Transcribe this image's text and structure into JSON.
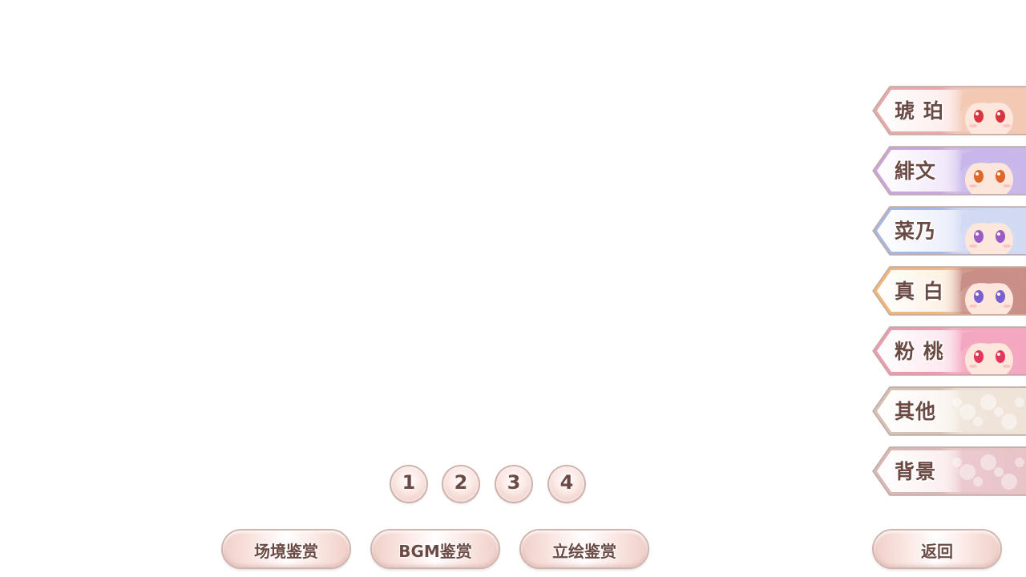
{
  "character_tabs": [
    {
      "label": "琥 珀",
      "palette": {
        "edge": "#e8a9a9",
        "base": "#fdeeee",
        "hair": "#f2c9b3",
        "eye": "#d9343f"
      }
    },
    {
      "label": "緋文",
      "palette": {
        "edge": "#c9a6d9",
        "base": "#f3e9fa",
        "hair": "#c8b8ea",
        "eye": "#e0662a"
      }
    },
    {
      "label": "菜乃",
      "palette": {
        "edge": "#a9b6df",
        "base": "#eef1fb",
        "hair": "#d2d9f3",
        "eye": "#9a5bc6"
      }
    },
    {
      "label": "真 白",
      "palette": {
        "edge": "#f0b77a",
        "base": "#fdf1e4",
        "hair": "#c98e86",
        "eye": "#7a5fd0"
      }
    },
    {
      "label": "粉 桃",
      "palette": {
        "edge": "#ec9bb2",
        "base": "#fde9ef",
        "hair": "#f4a7c0",
        "eye": "#e2365a"
      }
    },
    {
      "label": "其他",
      "palette": {
        "edge": "#d6c2b4",
        "base": "#fbf6f1",
        "hair": "#efe3d8",
        "eye": "#efe3d8"
      }
    },
    {
      "label": "背景",
      "palette": {
        "edge": "#d9b9b8",
        "base": "#fbeff0",
        "hair": "#e8c3c8",
        "eye": "#e8c3c8"
      }
    }
  ],
  "pages": [
    "1",
    "2",
    "3",
    "4"
  ],
  "bottom_nav": {
    "scene": "场境鉴赏",
    "bgm": "BGM鉴赏",
    "standing": "立绘鉴赏",
    "back": "返回"
  },
  "colors": {
    "text": "#6b4a44",
    "button_face": "#fae6e2",
    "button_edge": "#cfb5ae"
  }
}
